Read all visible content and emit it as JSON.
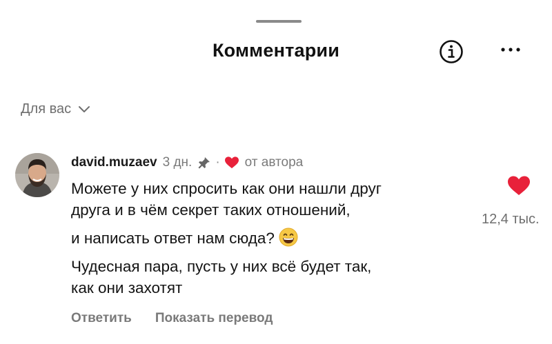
{
  "header": {
    "title": "Комментарии",
    "info_icon": "info-circle-icon",
    "more_icon": "more-dots-icon"
  },
  "filter": {
    "label": "Для вас",
    "icon": "chevron-down-icon"
  },
  "comment": {
    "avatar_icon": "user-avatar",
    "username": "david.muzaev",
    "time": "3 дн.",
    "pinned_icon": "pin-icon",
    "separator": "·",
    "author_like_icon": "heart-icon",
    "author_like_label": "от автора",
    "lines": [
      "Можете у них спросить как они нашли друг",
      "друга и в чём секрет таких отношений,",
      "и написать ответ нам сюда?",
      "Чудесная пара, пусть у них всё будет так,",
      "как они захотят"
    ],
    "emoji": "grinning-face-emoji",
    "like_icon": "heart-filled-icon",
    "like_count": "12,4 тыс.",
    "reply_label": "Ответить",
    "translate_label": "Показать перевод"
  },
  "colors": {
    "heart": "#e8213a",
    "muted_text": "#7a7a7a",
    "text": "#141414"
  }
}
